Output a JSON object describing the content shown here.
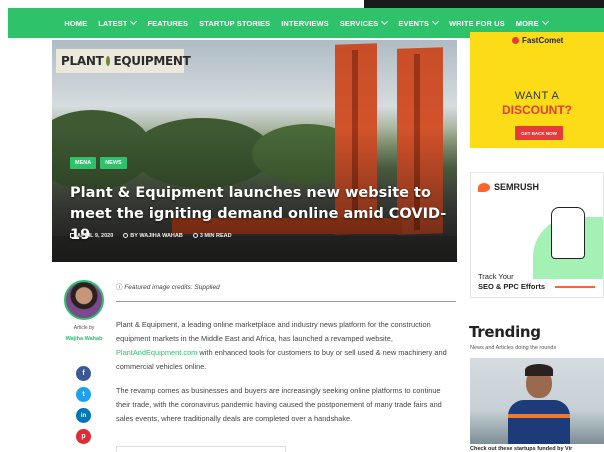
{
  "nav": {
    "items": [
      {
        "label": "HOME",
        "dropdown": false
      },
      {
        "label": "LATEST",
        "dropdown": true
      },
      {
        "label": "FEATURES",
        "dropdown": false
      },
      {
        "label": "STARTUP STORIES",
        "dropdown": false
      },
      {
        "label": "INTERVIEWS",
        "dropdown": false
      },
      {
        "label": "SERVICES",
        "dropdown": true
      },
      {
        "label": "EVENTS",
        "dropdown": true
      },
      {
        "label": "WRITE FOR US",
        "dropdown": false
      },
      {
        "label": "MORE",
        "dropdown": true
      }
    ],
    "accent": "#2ec26a"
  },
  "hero": {
    "logo_left": "PLANT",
    "logo_right": "EQUIPMENT",
    "badges": [
      "MENA",
      "NEWS"
    ],
    "title": "Plant & Equipment launches new website to meet the igniting demand online amid COVID-19",
    "date": "APRIL 9, 2020",
    "author": "BY WAJIHA WAHAB",
    "read_time": "3 MIN READ"
  },
  "author": {
    "article_by": "Article by",
    "name": "Wajiha Wahab"
  },
  "social": [
    {
      "icon": "facebook-icon",
      "glyph": "f",
      "color": "#3b5998"
    },
    {
      "icon": "twitter-icon",
      "glyph": "t",
      "color": "#1da1f2"
    },
    {
      "icon": "linkedin-icon",
      "glyph": "in",
      "color": "#0077b5"
    },
    {
      "icon": "pinterest-icon",
      "glyph": "p",
      "color": "#e02a35"
    }
  ],
  "article": {
    "credit_label": "Featured image credits:",
    "credit_value": "Supplied",
    "para1_before": "Plant & Equipment, a leading online marketplace and industry news platform for the construction equipment markets in the Middle East and Africa, has launched a revamped website, ",
    "para1_link": "PlantAndEquipment.com",
    "para1_after": " with enhanced tools for customers to buy or sell used & new machinery and commercial vehicles online.",
    "para2": "The revamp comes as businesses and buyers are increasingly seeking online platforms to continue their trade, with the coronavirus pandemic having caused the postponement of many trade fairs and sales events, where traditionally deals are completed over a handshake."
  },
  "ad_fastcomet": {
    "brand": "FastComet",
    "line1": "WANT A",
    "line2": "DISCOUNT?",
    "button": "GET BACK NOW"
  },
  "ad_semrush": {
    "brand": "SEMRUSH",
    "line1": "Track Your",
    "line2": "SEO & PPC Efforts"
  },
  "trending": {
    "title": "Trending",
    "subtitle": "News and Articles doing the rounds",
    "caption": "Check out these startups funded by Vir"
  }
}
